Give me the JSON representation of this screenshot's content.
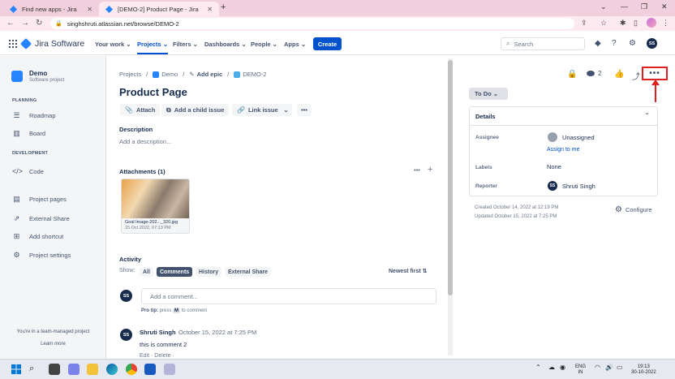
{
  "browser": {
    "tabs": [
      {
        "label": "Find new apps - Jira",
        "active": false
      },
      {
        "label": "[DEMO-2] Product Page - Jira",
        "active": true
      }
    ],
    "url": "singhshruti.atlassian.net/browse/DEMO-2"
  },
  "jira_nav": {
    "logo": "Jira Software",
    "menu": [
      "Your work",
      "Projects",
      "Filters",
      "Dashboards",
      "People",
      "Apps"
    ],
    "active_menu": "Projects",
    "create_label": "Create",
    "search_placeholder": "Search",
    "user_initials": "SS"
  },
  "sidebar": {
    "project_name": "Demo",
    "project_type": "Software project",
    "planning_heading": "PLANNING",
    "planning_items": [
      "Roadmap",
      "Board"
    ],
    "development_heading": "DEVELOPMENT",
    "development_items": [
      "Code"
    ],
    "other_items": [
      "Project pages",
      "External Share",
      "Add shortcut",
      "Project settings"
    ],
    "footer_line1": "You're in a team-managed project",
    "footer_line2": "Learn more"
  },
  "issue": {
    "breadcrumbs": [
      "Projects",
      "Demo",
      "Add epic",
      "DEMO-2"
    ],
    "title": "Product Page",
    "toolbar": [
      "Attach",
      "Add a child issue",
      "Link issue"
    ],
    "description_label": "Description",
    "description_placeholder": "Add a description...",
    "attachments_label": "Attachments (1)",
    "attachment": {
      "filename": "Goal Image-202..._320.jpg",
      "date": "15 Oct 2022, 07:13 PM"
    },
    "activity_label": "Activity",
    "show_label": "Show:",
    "activity_tabs": [
      "All",
      "Comments",
      "History",
      "External Share"
    ],
    "activity_selected": "Comments",
    "sort_label": "Newest first",
    "comment_placeholder": "Add a comment...",
    "pro_tip_prefix": "Pro tip:",
    "pro_tip_press": "press",
    "pro_tip_key": "M",
    "pro_tip_suffix": "to comment",
    "comment": {
      "author": "Shruti Singh",
      "time": "October 15, 2022 at 7:25 PM",
      "body": "this is comment 2",
      "actions": "Edit · Delete ·"
    }
  },
  "right_panel": {
    "watch_count": "2",
    "more_label": "•••",
    "status": "To Do",
    "details_heading": "Details",
    "fields": {
      "assignee_label": "Assignee",
      "assignee_value": "Unassigned",
      "assign_to_me": "Assign to me",
      "labels_label": "Labels",
      "labels_value": "None",
      "reporter_label": "Reporter",
      "reporter_value": "Shruti Singh",
      "reporter_initials": "SS"
    },
    "created": "Created October 14, 2022 at 12:19 PM",
    "updated": "Updated October 15, 2022 at 7:25 PM",
    "configure": "Configure"
  },
  "taskbar": {
    "lang_line1": "ENG",
    "lang_line2": "IN",
    "time": "19:13",
    "date": "30-10-2022"
  }
}
